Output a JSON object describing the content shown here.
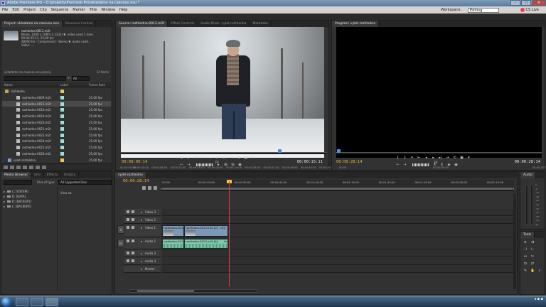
{
  "window": {
    "title": "Adobe Premiere Pro - D:\\projekty\\Premiere Pro\\vkladame na casovou osu *"
  },
  "menu": [
    "File",
    "Edit",
    "Project",
    "Clip",
    "Sequence",
    "Marker",
    "Title",
    "Window",
    "Help"
  ],
  "workspace": {
    "label": "Workspace:",
    "value": "Editing"
  },
  "cslive": {
    "label": "CS Live"
  },
  "project": {
    "tabs": [
      "Project: vkladame na casovou osu",
      "Resource Central"
    ],
    "clip_name": "rozhledna-0013.m2t",
    "clip_info": [
      "Movie, 1440 x 1080 (1,3333) ▼, video used 1 time",
      "00:00:15:11, 25,00 fps",
      "48000 Hz - Compressed - Stereo ▼, audio used...",
      "Video: ..."
    ],
    "project_file": "vkladame na casovou osu.prproj",
    "item_count": "12 Items",
    "in_label": "In:",
    "in_value": "All",
    "columns": {
      "name": "Name",
      "label": "Label",
      "frame_rate": "Frame Rate"
    },
    "rows": [
      {
        "name": "rozhledna",
        "type": "bin",
        "fps": "",
        "label_color": "#e9c85a"
      },
      {
        "name": "rozhledna-0009.m2t",
        "type": "clip",
        "fps": "25,00 fps",
        "label_color": "#9ee0d6"
      },
      {
        "name": "rozhledna-0013.m2t",
        "type": "clip",
        "fps": "25,00 fps",
        "label_color": "#9ee0d6"
      },
      {
        "name": "rozhledna-0016.m2t",
        "type": "clip",
        "fps": "25,00 fps",
        "label_color": "#9ee0d6"
      },
      {
        "name": "rozhledna-0019.m2t",
        "type": "clip",
        "fps": "25,00 fps",
        "label_color": "#9ee0d6"
      },
      {
        "name": "rozhledna-0020.m2t",
        "type": "clip",
        "fps": "25,00 fps",
        "label_color": "#9ee0d6"
      },
      {
        "name": "rozhledna-0021.m2t",
        "type": "clip",
        "fps": "25,00 fps",
        "label_color": "#9ee0d6"
      },
      {
        "name": "rozhledna-0022.m2t",
        "type": "clip",
        "fps": "25,00 fps",
        "label_color": "#9ee0d6"
      },
      {
        "name": "rozhledna-0024.m2t",
        "type": "clip",
        "fps": "25,00 fps",
        "label_color": "#9ee0d6"
      },
      {
        "name": "rozhledna-0025.m2t",
        "type": "clip",
        "fps": "25,00 fps",
        "label_color": "#9ee0d6"
      },
      {
        "name": "rozhledna-0026.m2t",
        "type": "clip",
        "fps": "25,00 fps",
        "label_color": "#9ee0d6"
      },
      {
        "name": "vylet-rozhledna",
        "type": "sequence",
        "fps": "25,00 fps",
        "label_color": "#e9c85a"
      }
    ]
  },
  "source": {
    "tabs": [
      "Source: rozhledna-0013.m2t",
      "Effect Controls",
      "Audio Mixer: vylet-rozhledna",
      "Metadata"
    ],
    "timecode": "00:00:00:14",
    "duration": "00:00:15:11",
    "fit": "Fit",
    "ruler": [
      "00:00:00:00",
      "00:00:04:00",
      "00:00:08:00",
      "00:00:12:00",
      "00:00:16:00",
      "00:00:20:00",
      "00:00:24:00",
      "00:00:28:00",
      "00:00:32:00",
      "00:00:36:00",
      "00:00:40:00",
      "00:00:44:00"
    ]
  },
  "program": {
    "tabs": [
      "Program: vylet-rozhledna"
    ],
    "timecode": "00:00:28:14",
    "duration": "00:00:28:14",
    "fit": "Fit",
    "ruler": [
      "00:00",
      "00:00:05:00",
      "00:00:10:00"
    ]
  },
  "media_browser": {
    "tabs": [
      "Media Browser",
      "Info",
      "Effects",
      "History"
    ],
    "files_of_type_label": "Files of type:",
    "files_of_type_value": "All Supported Files",
    "view_as_label": "View as:",
    "drives": [
      "C: [OSTEM]",
      "D: [DATA]",
      "K: [BACKUP1]",
      "L: [BACKUP2]"
    ]
  },
  "timeline": {
    "tabs": [
      "vylet-rozhledna"
    ],
    "timecode": "00:00:28:14",
    "ruler": [
      "00:00",
      "00:00:15:00",
      "00:00:30:00",
      "00:00:45:00",
      "00:01:00:00",
      "00:01:15:00",
      "00:01:30:00",
      "00:01:45:00",
      "00:02:00:00",
      "00:02:15:00"
    ],
    "tracks": [
      {
        "name": "Video 3"
      },
      {
        "name": "Video 2"
      },
      {
        "name": "Video 1",
        "source": "V"
      },
      {
        "name": "Audio 1",
        "source": "A1"
      },
      {
        "name": "Audio 2"
      },
      {
        "name": "Audio 3"
      },
      {
        "name": "Master"
      }
    ],
    "video_clips": [
      "rozhledna-0013",
      "rozhledna-0013.m2t [V]",
      "city"
    ],
    "audio_clips": [
      "rozhledna-0013",
      "rozhledna-0013.m2t [A]",
      "Vol"
    ]
  },
  "audio_meters": {
    "tab": "Audio",
    "scale": [
      "0",
      "-6",
      "-12",
      "-18",
      "-24",
      "-30",
      "-36",
      "-42",
      "-48",
      "-54",
      "dB"
    ]
  },
  "tools": {
    "tab": "Tools"
  }
}
